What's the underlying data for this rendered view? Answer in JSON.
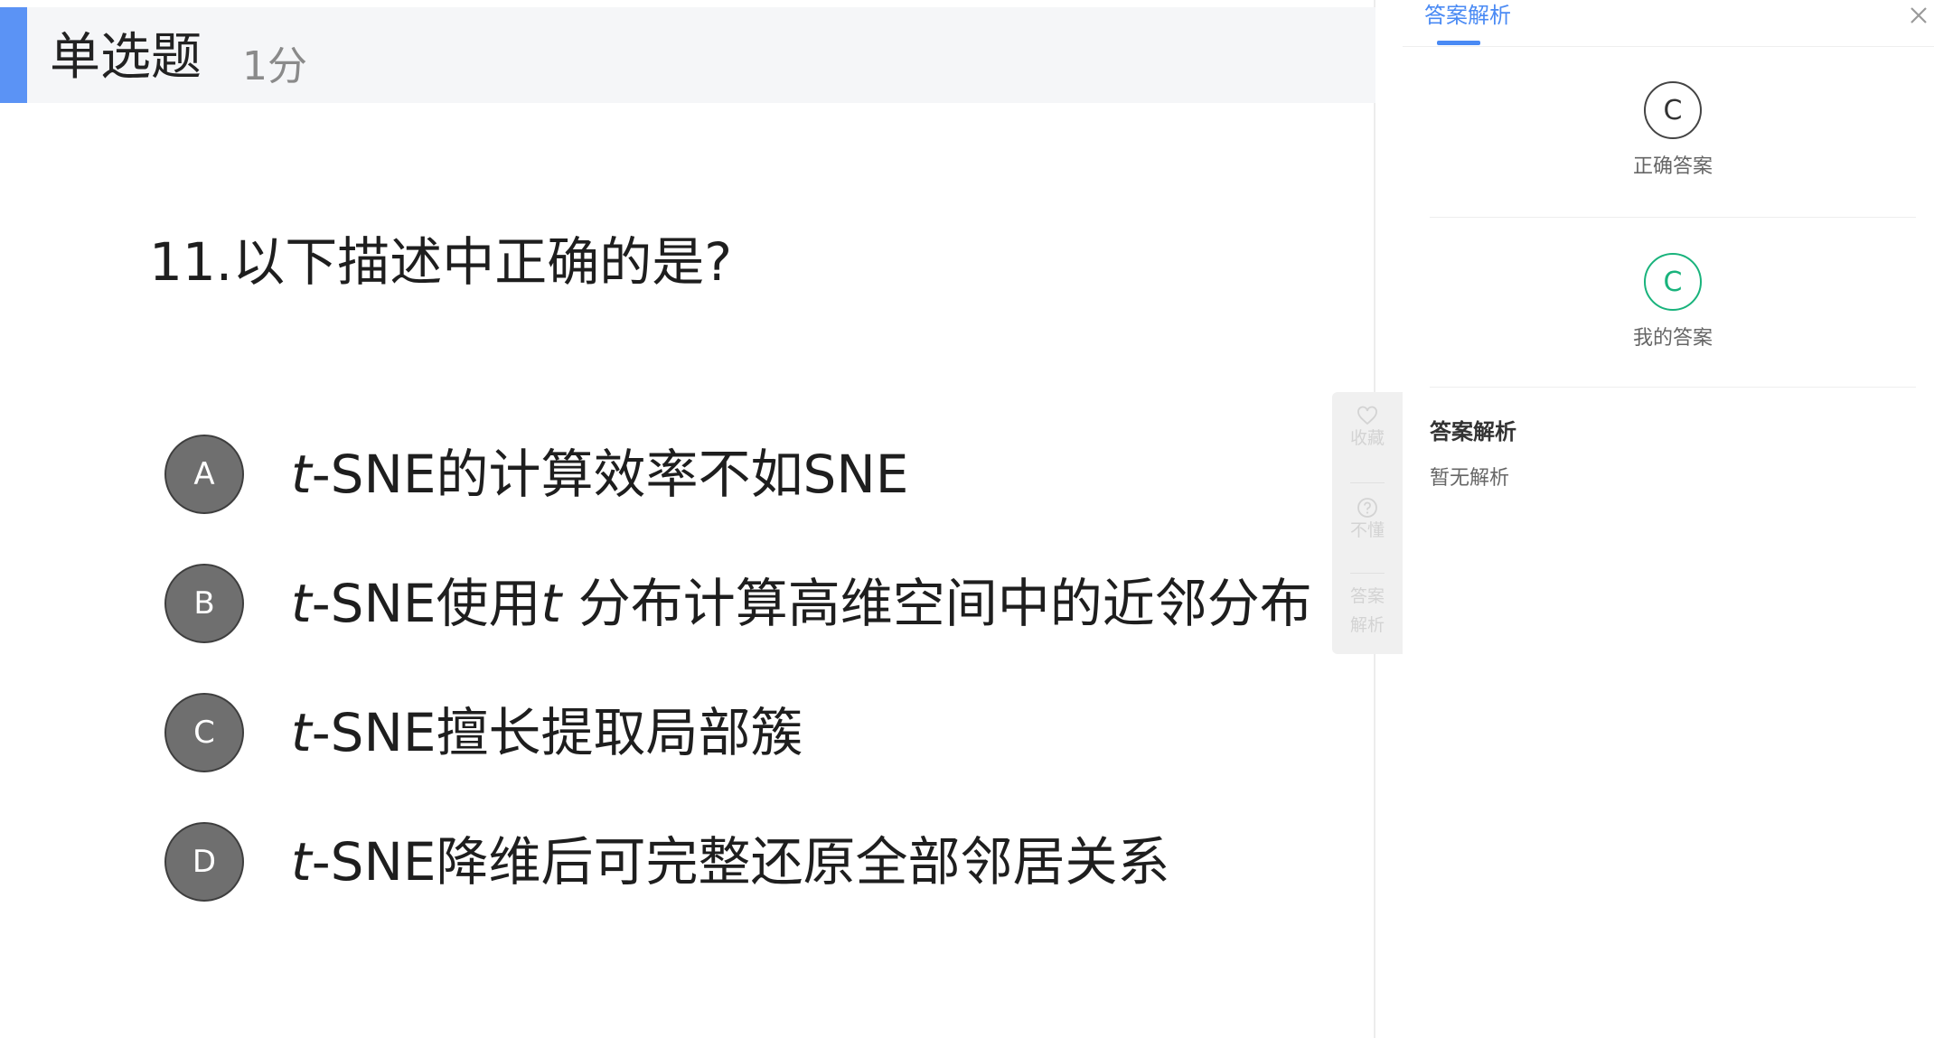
{
  "header": {
    "title": "单选题",
    "score": "1分",
    "accent_color": "#5b93f5"
  },
  "question": {
    "text": "11.以下描述中正确的是?"
  },
  "options": [
    {
      "letter": "A",
      "parts": [
        {
          "t": "t",
          "italic": true
        },
        {
          "t": "-SNE的计算效率不如SNE",
          "italic": false
        }
      ]
    },
    {
      "letter": "B",
      "parts": [
        {
          "t": "t",
          "italic": true
        },
        {
          "t": "-SNE使用",
          "italic": false
        },
        {
          "t": "t",
          "italic": true
        },
        {
          "t": " 分布计算高维空间中的近邻分布",
          "italic": false
        }
      ]
    },
    {
      "letter": "C",
      "parts": [
        {
          "t": "t",
          "italic": true
        },
        {
          "t": "-SNE擅长提取局部簇",
          "italic": false
        }
      ]
    },
    {
      "letter": "D",
      "parts": [
        {
          "t": "t",
          "italic": true
        },
        {
          "t": "-SNE降维后可完整还原全部邻居关系",
          "italic": false
        }
      ]
    }
  ],
  "tools": {
    "favorite_label": "收藏",
    "confused_label": "不懂",
    "analysis_label_1": "答案",
    "analysis_label_2": "解析",
    "favorite_icon": "heart-icon",
    "confused_icon": "question-circle-icon"
  },
  "panel": {
    "tab_label": "答案解析",
    "close_icon": "close-icon",
    "correct_answer": {
      "value": "C",
      "label": "正确答案"
    },
    "my_answer": {
      "value": "C",
      "label": "我的答案",
      "color": "#19b37c"
    },
    "analysis_title": "答案解析",
    "analysis_body": "暂无解析",
    "accent_color": "#4a8af4"
  }
}
